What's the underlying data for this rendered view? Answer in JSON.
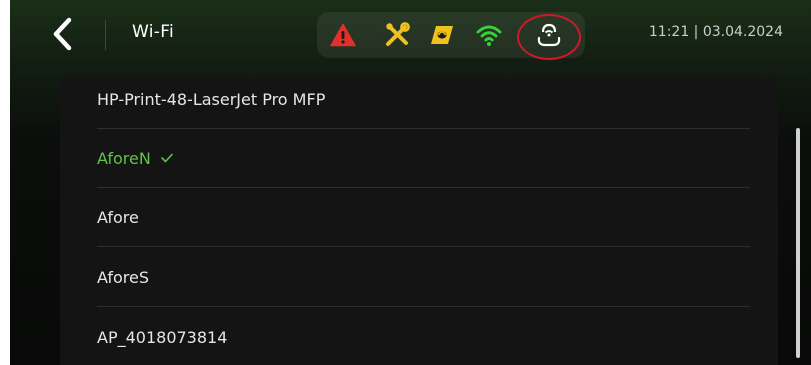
{
  "header": {
    "back_icon": "chevron-left-icon",
    "title": "Wi-Fi",
    "datetime": "11:21 | 03.04.2024"
  },
  "status_icons": [
    {
      "name": "warning-icon",
      "color": "#e0302b"
    },
    {
      "name": "service-tools-icon",
      "color": "#f0c21c"
    },
    {
      "name": "compressor-icon",
      "color": "#f0c21c"
    },
    {
      "name": "wifi-signal-icon",
      "color": "#39d03a"
    },
    {
      "name": "cloud-connection-icon",
      "color": "#ffffff"
    }
  ],
  "highlight": {
    "color": "#d0182a",
    "target": "cloud-connection-icon"
  },
  "networks": [
    {
      "ssid": "HP-Print-48-LaserJet Pro MFP",
      "connected": false
    },
    {
      "ssid": "AforeN",
      "connected": true
    },
    {
      "ssid": "Afore",
      "connected": false
    },
    {
      "ssid": "AforeS",
      "connected": false
    },
    {
      "ssid": "AP_4018073814",
      "connected": false
    }
  ],
  "colors": {
    "connected": "#5ec446",
    "text": "#e6e6e6"
  }
}
